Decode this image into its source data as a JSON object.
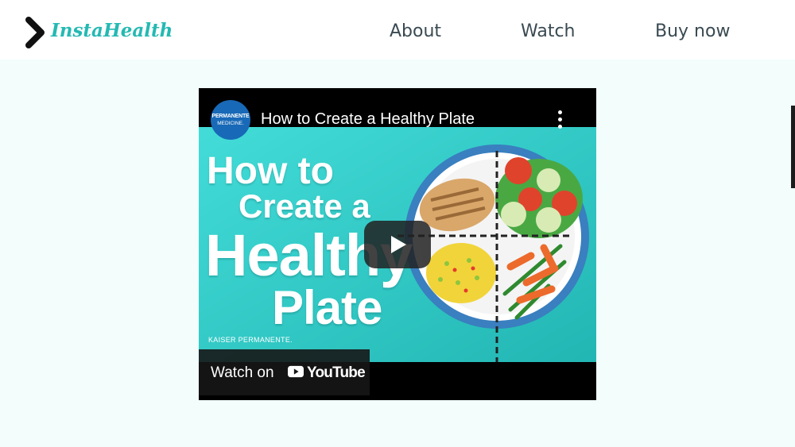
{
  "header": {
    "logo_text": "InstaHealth",
    "nav": [
      {
        "label": "About"
      },
      {
        "label": "Watch"
      },
      {
        "label": "Buy now"
      }
    ]
  },
  "video": {
    "channel_line1": "PERMANENTE",
    "channel_line2": "MEDICINE.",
    "title": "How to Create a Healthy Plate",
    "thumbnail_lines": [
      "How to",
      "Create a",
      "Healthy",
      "Plate"
    ],
    "thumbnail_brand": "KAISER PERMANENTE.",
    "watch_on_label": "Watch on",
    "youtube_label": "YouTube"
  },
  "colors": {
    "accent": "#25b9b3",
    "nav_text": "#3a4a52",
    "band_background": "#f2fdfc",
    "thumbnail_teal": "#3cd6d2"
  },
  "icons": {
    "logo": "chevron-right-icon",
    "menu": "more-vertical-icon",
    "play": "play-icon"
  }
}
